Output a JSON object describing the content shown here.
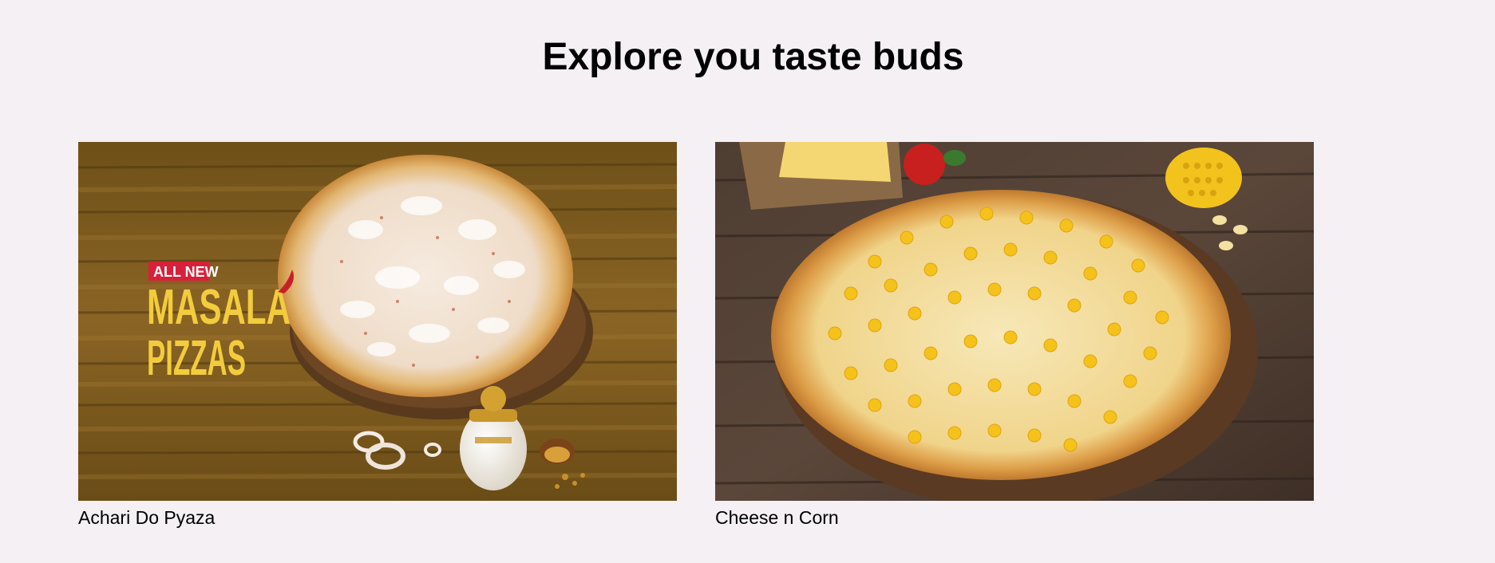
{
  "page": {
    "title": "Explore you taste buds"
  },
  "products": [
    {
      "name": "Achari Do Pyaza",
      "image": {
        "badge": "ALL NEW",
        "headline_line1": "MASALA",
        "headline_line2": "PIZZAS"
      }
    },
    {
      "name": "Cheese n Corn"
    }
  ],
  "colors": {
    "background": "#f4f0f4",
    "wood_warm": "#7a5a1e",
    "wood_dark": "#4a3a2e",
    "crust": "#d9a24a",
    "corn": "#f4c21a",
    "badge_red": "#d8203a",
    "headline_yellow": "#f2cc3d"
  }
}
